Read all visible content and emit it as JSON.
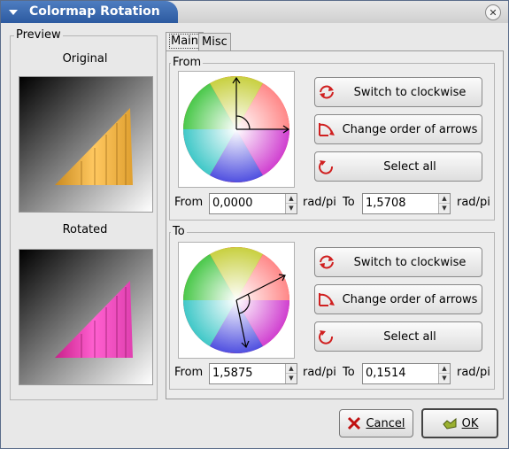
{
  "window": {
    "title": "Colormap Rotation",
    "close_icon": "close-icon",
    "menu_icon": "window-menu-icon"
  },
  "preview": {
    "group_label": "Preview",
    "original_label": "Original",
    "rotated_label": "Rotated"
  },
  "tabs": [
    {
      "label": "Main",
      "active": true
    },
    {
      "label": "Misc",
      "active": false
    }
  ],
  "from_group": {
    "label": "From",
    "buttons": {
      "switch": "Switch to clockwise",
      "change_order": "Change order of arrows",
      "select_all": "Select all"
    },
    "from_label": "From",
    "from_value": "0,0000",
    "unit1": "rad/pi",
    "to_label": "To",
    "to_value": "1,5708",
    "unit2": "rad/pi"
  },
  "to_group": {
    "label": "To",
    "buttons": {
      "switch": "Switch to clockwise",
      "change_order": "Change order of arrows",
      "select_all": "Select all"
    },
    "from_label": "From",
    "from_value": "1,5875",
    "unit1": "rad/pi",
    "to_label": "To",
    "to_value": "0,1514",
    "unit2": "rad/pi"
  },
  "footer": {
    "cancel": "Cancel",
    "ok": "OK"
  },
  "colors": {
    "title_bar": "#2c5aa0",
    "original_highlight": "#f4b040",
    "rotated_highlight": "#ff50c8"
  }
}
